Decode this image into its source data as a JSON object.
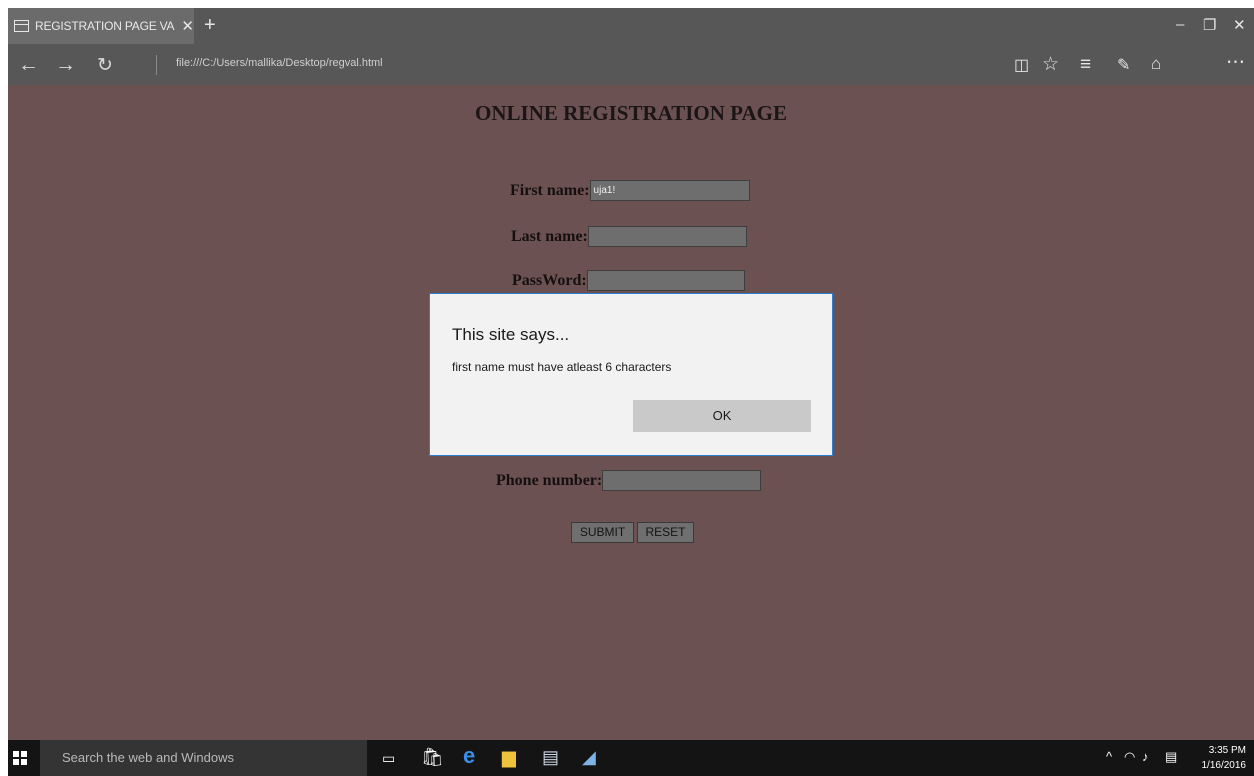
{
  "browser": {
    "tab_title": "REGISTRATION PAGE VA",
    "tab_close": "✕",
    "new_tab": "+",
    "url": "file:///C:/Users/mallika/Desktop/regval.html",
    "window_controls": {
      "minimize": "–",
      "maximize": "❐",
      "close": "✕"
    },
    "icons": [
      "back-arrow-icon",
      "forward-arrow-icon",
      "refresh-icon",
      "reading-view-icon",
      "favorite-star-icon",
      "hub-icon",
      "web-note-icon",
      "share-icon",
      "more-icon"
    ]
  },
  "page": {
    "title": "ONLINE REGISTRATION PAGE",
    "fields": {
      "first_name": {
        "label": "First name:",
        "value": "uja1!"
      },
      "last_name": {
        "label": "Last name:",
        "value": ""
      },
      "password": {
        "label": "PassWord:",
        "value": ""
      },
      "phone": {
        "label": "Phone number:",
        "value": ""
      }
    },
    "buttons": {
      "submit": "SUBMIT",
      "reset": "RESET"
    }
  },
  "dialog": {
    "title": "This site says...",
    "message": "first name must have atleast 6 characters",
    "ok": "OK"
  },
  "taskbar": {
    "search_placeholder": "Search the web and Windows",
    "time": "3:35 PM",
    "date": "1/16/2016",
    "icons": [
      "task-view-icon",
      "store-icon",
      "edge-icon",
      "file-explorer-icon",
      "word-icon",
      "notepad-icon"
    ]
  },
  "colors": {
    "page_background": "#6b5152",
    "dialog_border": "#2b7ed4",
    "taskbar": "#141414"
  }
}
